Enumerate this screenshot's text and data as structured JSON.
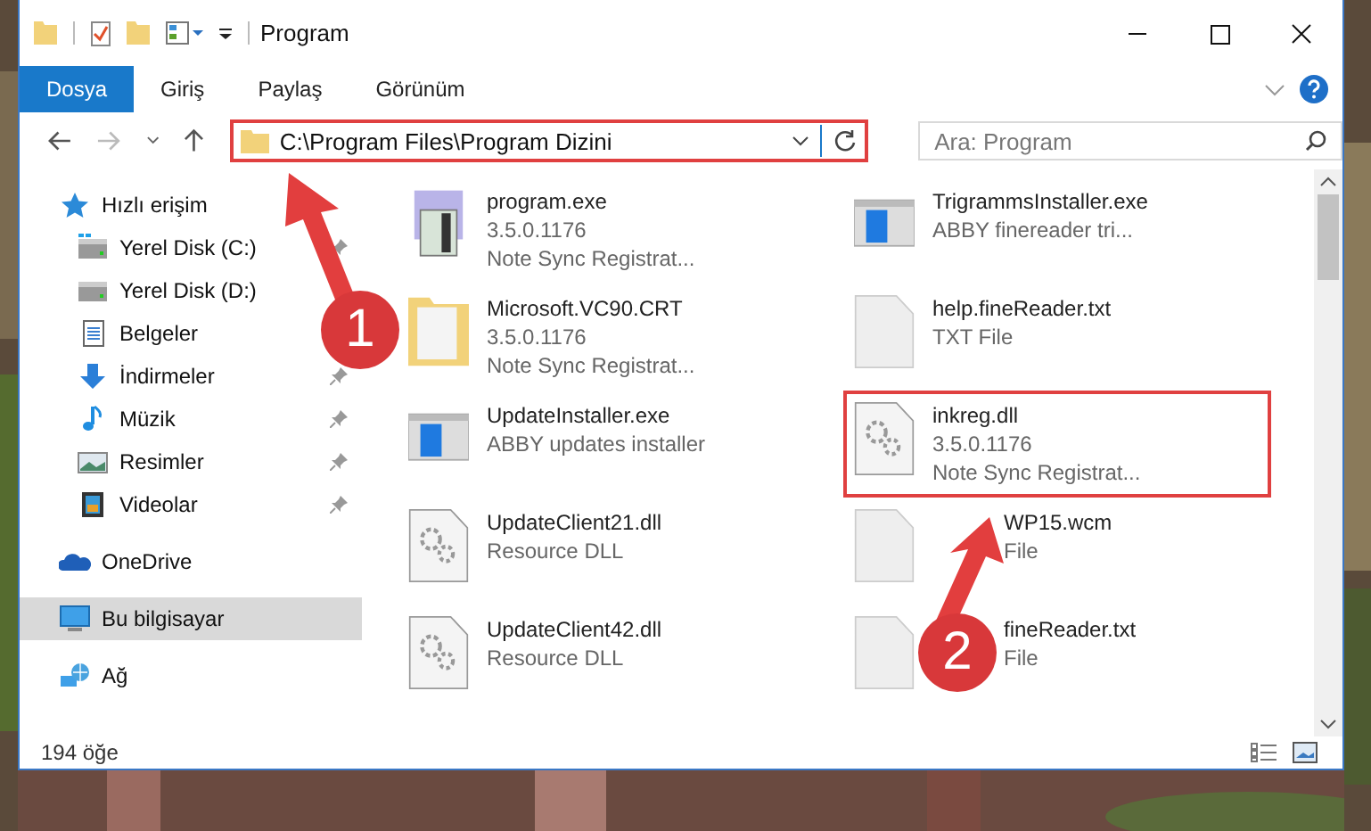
{
  "window": {
    "title": "Program"
  },
  "ribbon_tabs": [
    {
      "label": "Dosya",
      "selected": true
    },
    {
      "label": "Giriş",
      "selected": false
    },
    {
      "label": "Paylaş",
      "selected": false
    },
    {
      "label": "Görünüm",
      "selected": false
    }
  ],
  "address": {
    "path": "C:\\Program Files\\Program Dizini",
    "highlighted": true
  },
  "search": {
    "placeholder": "Ara: Program"
  },
  "sidebar": {
    "items": [
      {
        "label": "Hızlı erişim",
        "kind": "star",
        "selected": false,
        "children": [
          {
            "label": "Yerel Disk (C:)",
            "kind": "disk-c",
            "pinned": true,
            "selected": false
          },
          {
            "label": "Yerel Disk (D:)",
            "kind": "disk",
            "selected": false
          },
          {
            "label": "Belgeler",
            "kind": "docs",
            "selected": false
          },
          {
            "label": "İndirmeler",
            "kind": "download",
            "pinned": true,
            "selected": false
          },
          {
            "label": "Müzik",
            "kind": "music",
            "pinned": true,
            "selected": false
          },
          {
            "label": "Resimler",
            "kind": "pictures",
            "pinned": true,
            "selected": false
          },
          {
            "label": "Videolar",
            "kind": "videos",
            "pinned": true,
            "selected": false
          }
        ]
      },
      {
        "label": "OneDrive",
        "kind": "cloud",
        "selected": false
      },
      {
        "label": "Bu bilgisayar",
        "kind": "pc",
        "selected": true
      },
      {
        "label": "Ağ",
        "kind": "network",
        "selected": false
      }
    ]
  },
  "files": [
    {
      "name": "program.exe",
      "lines": [
        "3.5.0.1176",
        "Note Sync Registrat..."
      ],
      "kind": "exe",
      "highlighted": false,
      "partial": false
    },
    {
      "name": "TrigrammsInstaller.exe",
      "lines": [
        "ABBY finereader tri..."
      ],
      "kind": "installer",
      "highlighted": false,
      "partial": false
    },
    {
      "name": "Microsoft.VC90.CRT",
      "lines": [
        "3.5.0.1176",
        "Note Sync Registrat..."
      ],
      "kind": "folder",
      "highlighted": false,
      "partial": false
    },
    {
      "name": "help.fineReader.txt",
      "lines": [
        "TXT File"
      ],
      "kind": "doc",
      "highlighted": false,
      "partial": false
    },
    {
      "name": "UpdateInstaller.exe",
      "lines": [
        "ABBY updates installer"
      ],
      "kind": "installer",
      "highlighted": false,
      "partial": false
    },
    {
      "name": "inkreg.dll",
      "lines": [
        "3.5.0.1176",
        "Note Sync Registrat..."
      ],
      "kind": "dll",
      "highlighted": true,
      "partial": false
    },
    {
      "name": "UpdateClient21.dll",
      "lines": [
        "Resource DLL"
      ],
      "kind": "dll",
      "highlighted": false,
      "partial": false
    },
    {
      "name": "WP15.wcm",
      "lines": [
        "File"
      ],
      "kind": "doc",
      "highlighted": false,
      "partial": true
    },
    {
      "name": "UpdateClient42.dll",
      "lines": [
        "Resource DLL"
      ],
      "kind": "dll",
      "highlighted": false,
      "partial": false
    },
    {
      "name": "fineReader.txt",
      "lines": [
        "File"
      ],
      "kind": "doc",
      "highlighted": false,
      "partial": true
    }
  ],
  "status_bar": {
    "count": "194 öğe"
  },
  "annotations": [
    {
      "number": "1"
    },
    {
      "number": "2"
    }
  ]
}
